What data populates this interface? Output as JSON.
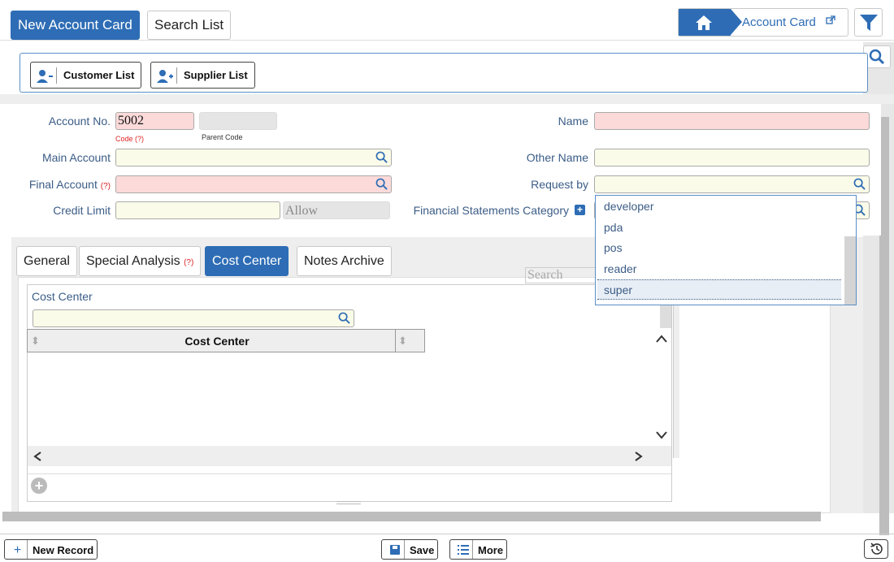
{
  "top_tabs": [
    "New Account Card",
    "Search List"
  ],
  "breadcrumb": {
    "label": "Account Card"
  },
  "actions": {
    "customer_list": "Customer List",
    "supplier_list": "Supplier List"
  },
  "form": {
    "account_no_label": "Account No.",
    "account_no_value": "5002",
    "code_hint": "Code",
    "help_mark": "(?)",
    "parent_code_label": "Parent Code",
    "name_label": "Name",
    "main_account_label": "Main Account",
    "other_name_label": "Other Name",
    "final_account_label": "Final Account",
    "request_by_label": "Request by",
    "credit_limit_label": "Credit Limit",
    "allow_label": "Allow",
    "fin_stmt_label": "Financial Statements Category"
  },
  "dropdown": {
    "items": [
      "developer",
      "pda",
      "pos",
      "reader",
      "super"
    ],
    "selected": "super"
  },
  "tabs": [
    "General",
    "Special Analysis",
    "Cost Center",
    "Notes Archive"
  ],
  "active_tab": "Cost Center",
  "cost_center": {
    "title": "Cost Center",
    "column": "Cost Center",
    "search_placeholder": "Search"
  },
  "bottom": {
    "new_record": "New Record",
    "save": "Save",
    "more": "More"
  },
  "colors": {
    "accent": "#2e6db5",
    "required": "#fcdada",
    "optional": "#fafbe8"
  }
}
